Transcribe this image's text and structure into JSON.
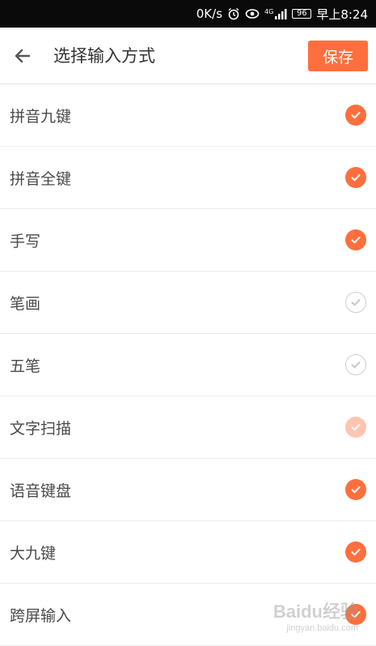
{
  "status_bar": {
    "speed": "0K/s",
    "network": "4G",
    "battery": "96",
    "time": "早上8:24"
  },
  "header": {
    "back_icon": "arrow-left-icon",
    "title": "选择输入方式",
    "save_label": "保存"
  },
  "accent_color": "#ff6f3d",
  "items": [
    {
      "label": "拼音九键",
      "state": "on"
    },
    {
      "label": "拼音全键",
      "state": "on"
    },
    {
      "label": "手写",
      "state": "on"
    },
    {
      "label": "笔画",
      "state": "off"
    },
    {
      "label": "五笔",
      "state": "off"
    },
    {
      "label": "文字扫描",
      "state": "dim"
    },
    {
      "label": "语音键盘",
      "state": "on"
    },
    {
      "label": "大九键",
      "state": "on"
    },
    {
      "label": "跨屏输入",
      "state": "on"
    }
  ],
  "watermark": {
    "logo": "Baidu经验",
    "sub": "jingyan.baidu.com"
  }
}
